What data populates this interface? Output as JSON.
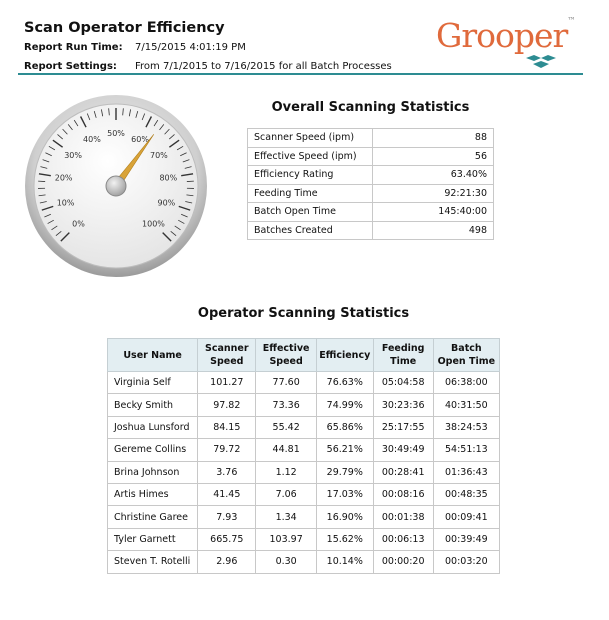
{
  "report": {
    "title": "Scan Operator Efficiency",
    "run_time_label": "Report Run Time:",
    "run_time_value": "7/15/2015 4:01:19 PM",
    "settings_label": "Report Settings:",
    "settings_value": "From 7/1/2015 to 7/16/2015 for all Batch Processes"
  },
  "logo": {
    "text": "Grooper",
    "trademark": "™",
    "colors": [
      "#e06a3c",
      "#2d8c92"
    ]
  },
  "gauge": {
    "value_percent": 63.4,
    "min": 0,
    "max": 100,
    "tick_labels": [
      "0%",
      "10%",
      "20%",
      "30%",
      "40%",
      "50%",
      "60%",
      "70%",
      "80%",
      "90%",
      "100%"
    ],
    "needle_color": "#d9a338"
  },
  "overall": {
    "title": "Overall Scanning Statistics",
    "rows": [
      {
        "label": "Scanner Speed (ipm)",
        "value": "88"
      },
      {
        "label": "Effective Speed (ipm)",
        "value": "56"
      },
      {
        "label": "Efficiency Rating",
        "value": "63.40%"
      },
      {
        "label": "Feeding Time",
        "value": "92:21:30"
      },
      {
        "label": "Batch Open Time",
        "value": "145:40:00"
      },
      {
        "label": "Batches Created",
        "value": "498"
      }
    ]
  },
  "operators": {
    "title": "Operator Scanning Statistics",
    "columns": [
      "User Name",
      "Scanner Speed",
      "Effective Speed",
      "Efficiency",
      "Feeding Time",
      "Batch Open Time"
    ],
    "rows": [
      [
        "Virginia Self",
        "101.27",
        "77.60",
        "76.63%",
        "05:04:58",
        "06:38:00"
      ],
      [
        "Becky Smith",
        "97.82",
        "73.36",
        "74.99%",
        "30:23:36",
        "40:31:50"
      ],
      [
        "Joshua Lunsford",
        "84.15",
        "55.42",
        "65.86%",
        "25:17:55",
        "38:24:53"
      ],
      [
        "Gereme Collins",
        "79.72",
        "44.81",
        "56.21%",
        "30:49:49",
        "54:51:13"
      ],
      [
        "Brina Johnson",
        "3.76",
        "1.12",
        "29.79%",
        "00:28:41",
        "01:36:43"
      ],
      [
        "Artis Himes",
        "41.45",
        "7.06",
        "17.03%",
        "00:08:16",
        "00:48:35"
      ],
      [
        "Christine Garee",
        "7.93",
        "1.34",
        "16.90%",
        "00:01:38",
        "00:09:41"
      ],
      [
        "Tyler Garnett",
        "665.75",
        "103.97",
        "15.62%",
        "00:06:13",
        "00:39:49"
      ],
      [
        "Steven T. Rotelli",
        "2.96",
        "0.30",
        "10.14%",
        "00:00:20",
        "00:03:20"
      ]
    ]
  }
}
